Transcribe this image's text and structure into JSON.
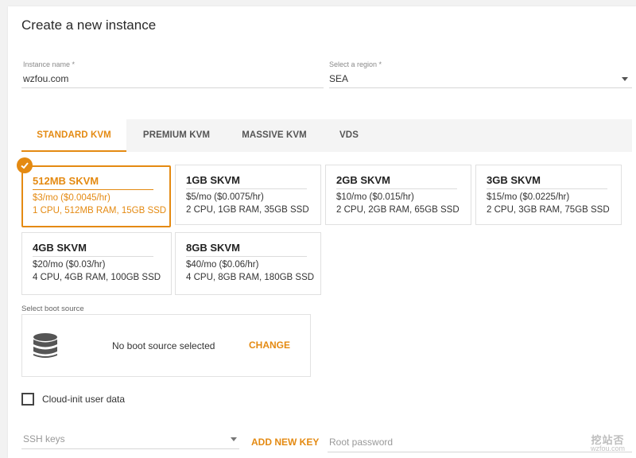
{
  "page": {
    "title": "Create a new instance"
  },
  "form": {
    "instance_name_label": "Instance name *",
    "instance_name_value": "wzfou.com",
    "region_label": "Select a region *",
    "region_value": "SEA"
  },
  "tabs": [
    {
      "label": "STANDARD KVM",
      "active": true
    },
    {
      "label": "PREMIUM KVM",
      "active": false
    },
    {
      "label": "MASSIVE KVM",
      "active": false
    },
    {
      "label": "VDS",
      "active": false
    }
  ],
  "plans": [
    {
      "name": "512MB SKVM",
      "price": "$3/mo ($0.0045/hr)",
      "specs": "1 CPU, 512MB RAM, 15GB SSD",
      "selected": true
    },
    {
      "name": "1GB SKVM",
      "price": "$5/mo ($0.0075/hr)",
      "specs": "2 CPU, 1GB RAM, 35GB SSD",
      "selected": false
    },
    {
      "name": "2GB SKVM",
      "price": "$10/mo ($0.015/hr)",
      "specs": "2 CPU, 2GB RAM, 65GB SSD",
      "selected": false
    },
    {
      "name": "3GB SKVM",
      "price": "$15/mo ($0.0225/hr)",
      "specs": "2 CPU, 3GB RAM, 75GB SSD",
      "selected": false
    },
    {
      "name": "4GB SKVM",
      "price": "$20/mo ($0.03/hr)",
      "specs": "4 CPU, 4GB RAM, 100GB SSD",
      "selected": false
    },
    {
      "name": "8GB SKVM",
      "price": "$40/mo ($0.06/hr)",
      "specs": "4 CPU, 8GB RAM, 180GB SSD",
      "selected": false
    }
  ],
  "boot": {
    "label": "Select boot source",
    "status": "No boot source selected",
    "change_label": "CHANGE"
  },
  "cloud_init": {
    "label": "Cloud-init user data",
    "checked": false
  },
  "ssh": {
    "placeholder": "SSH keys",
    "add_key_label": "ADD NEW KEY",
    "root_password_placeholder": "Root password"
  },
  "watermark": {
    "logo_text": "挖站否",
    "site": "wzfou.com"
  },
  "colors": {
    "accent": "#e48a12",
    "text": "#333333",
    "muted": "#8a8a8a"
  }
}
